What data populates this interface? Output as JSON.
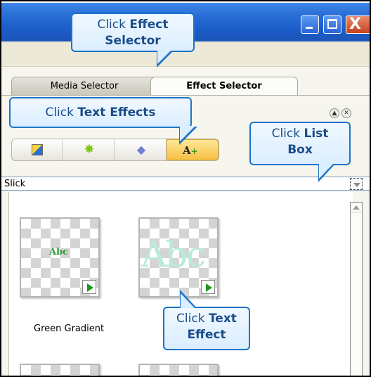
{
  "window": {
    "min_icon": "minimize-icon",
    "max_icon": "maximize-icon",
    "close_icon": "close-icon",
    "close_glyph": "X"
  },
  "tabs": [
    {
      "label": "Media Selector",
      "active": false
    },
    {
      "label": "Effect Selector",
      "active": true
    }
  ],
  "panel_controls": {
    "collapse_glyph": "▲",
    "close_glyph": "✕"
  },
  "categories": [
    {
      "icon": "transition-icon",
      "selected": false
    },
    {
      "icon": "starburst-effect-icon",
      "selected": false
    },
    {
      "icon": "layers-icon",
      "selected": false
    },
    {
      "icon": "text-effect-icon",
      "selected": true,
      "glyph": "A",
      "glyph_plus": "+"
    }
  ],
  "dropdown": {
    "value": "Slick"
  },
  "thumbnails": [
    {
      "sample_text": "Abc",
      "sample_color": "#2e9a2e",
      "caption": "Green Gradient"
    },
    {
      "sample_text": "Abc",
      "sample_color": "#b8ecd8",
      "caption": ""
    }
  ],
  "callouts": {
    "effect_selector": {
      "pre": "Click ",
      "bold": "Effect",
      "line2": "Selector"
    },
    "text_effects": {
      "pre": "Click ",
      "bold": "Text Effects"
    },
    "list_box": {
      "pre": "Click ",
      "bold": "List",
      "line2": "Box"
    },
    "text_effect": {
      "pre": "Click ",
      "bold": "Text",
      "line2": "Effect"
    }
  },
  "colors": {
    "titlebar": "#2a6fd6",
    "callout_border": "#1d74c7",
    "callout_text": "#1a4d8a",
    "selected_category": "#f6c042"
  }
}
